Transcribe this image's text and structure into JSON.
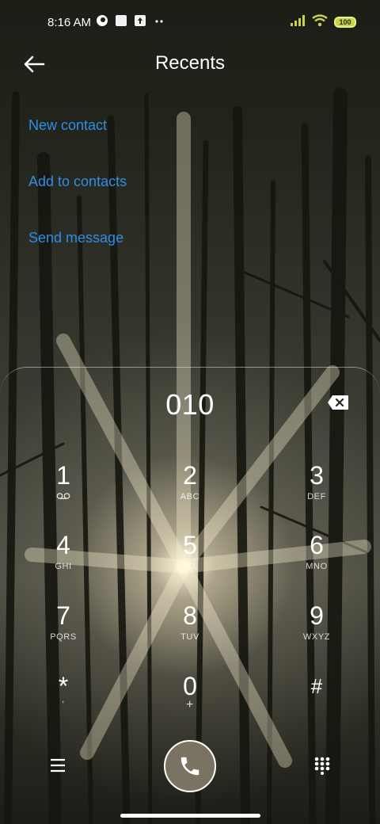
{
  "status_bar": {
    "time": "8:16 AM",
    "battery": "100",
    "icons": [
      "app-notification-icon",
      "square-notification-icon",
      "upload-icon",
      "more-dots-icon",
      "signal-icon",
      "wifi-icon",
      "battery-icon"
    ]
  },
  "header": {
    "title": "Recents",
    "back_icon": "arrow-left-icon"
  },
  "actions": {
    "new_contact": "New contact",
    "add_to_contacts": "Add to contacts",
    "send_message": "Send message"
  },
  "dialpad": {
    "number": "010",
    "keys": [
      {
        "digit": "1",
        "letters": ""
      },
      {
        "digit": "2",
        "letters": "ABC"
      },
      {
        "digit": "3",
        "letters": "DEF"
      },
      {
        "digit": "4",
        "letters": "GHI"
      },
      {
        "digit": "5",
        "letters": "JKL"
      },
      {
        "digit": "6",
        "letters": "MNO"
      },
      {
        "digit": "7",
        "letters": "PQRS"
      },
      {
        "digit": "8",
        "letters": "TUV"
      },
      {
        "digit": "9",
        "letters": "WXYZ"
      },
      {
        "digit": "*",
        "letters": ","
      },
      {
        "digit": "0",
        "letters": "+"
      },
      {
        "digit": "#",
        "letters": ""
      }
    ]
  },
  "colors": {
    "link": "#2f8de6",
    "call_button": "#7a7362"
  }
}
